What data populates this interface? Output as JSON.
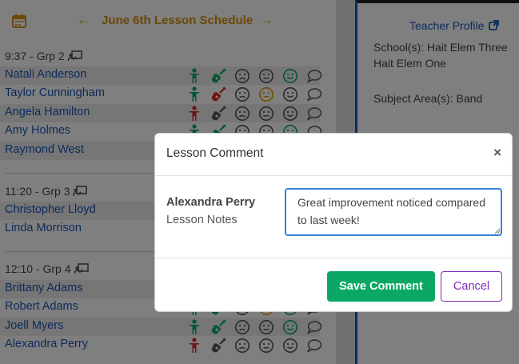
{
  "header": {
    "title": "June 6th Lesson Schedule",
    "prev_label": "←",
    "next_label": "→"
  },
  "groups": [
    {
      "heading": "9:37 - Grp 2",
      "students": [
        {
          "name": "Natali Anderson",
          "person": "green",
          "guitar": "green",
          "sad": "gray",
          "neutral": "gray",
          "happy": "green",
          "comment": "gray"
        },
        {
          "name": "Taylor Cunningham",
          "person": "green",
          "guitar": "red",
          "sad": "gray",
          "neutral": "orange",
          "happy": "gray",
          "comment": "gray"
        },
        {
          "name": "Angela Hamilton",
          "person": "red",
          "guitar": "gray",
          "sad": "gray",
          "neutral": "gray",
          "happy": "gray",
          "comment": "gray"
        },
        {
          "name": "Amy Holmes",
          "person": "green",
          "guitar": "green",
          "sad": "gray",
          "neutral": "gray",
          "happy": "green",
          "comment": "gray"
        },
        {
          "name": "Raymond West",
          "person": "green",
          "guitar": "green",
          "sad": "gray",
          "neutral": "gray",
          "happy": "green",
          "comment": "gray"
        }
      ]
    },
    {
      "heading": "11:20 - Grp 3",
      "students": [
        {
          "name": "Christopher Lloyd"
        },
        {
          "name": "Linda Morrison"
        }
      ]
    },
    {
      "heading": "12:10 - Grp 4",
      "students": [
        {
          "name": "Brittany Adams"
        },
        {
          "name": "Robert Adams",
          "neutral": "orange"
        },
        {
          "name": "Joell Myers",
          "person": "green",
          "guitar": "green",
          "sad": "gray",
          "neutral": "gray",
          "happy": "green",
          "comment": "gray"
        },
        {
          "name": "Alexandra Perry",
          "person": "red",
          "guitar": "gray",
          "sad": "gray",
          "neutral": "gray",
          "happy": "gray",
          "comment": "gray"
        }
      ]
    }
  ],
  "right_panel": {
    "teacher_profile_label": "Teacher Profile",
    "schools_line1": "School(s): Hait Elem Three",
    "schools_line2": "Hait Elem One",
    "subject_area": "Subject Area(s): Band"
  },
  "modal": {
    "title": "Lesson Comment",
    "close_label": "×",
    "student_name": "Alexandra Perry",
    "notes_label": "Lesson Notes",
    "notes_value": "Great improvement noticed compared to last week!",
    "save_label": "Save Comment",
    "cancel_label": "Cancel"
  },
  "colors": {
    "accent": "#d4900a",
    "link": "#1a56b8",
    "green": "#0aa864",
    "red": "#e02424",
    "orange": "#e69a0f",
    "gray": "#555555",
    "cancel": "#7b2bb8",
    "focus": "#3f7fd6"
  }
}
